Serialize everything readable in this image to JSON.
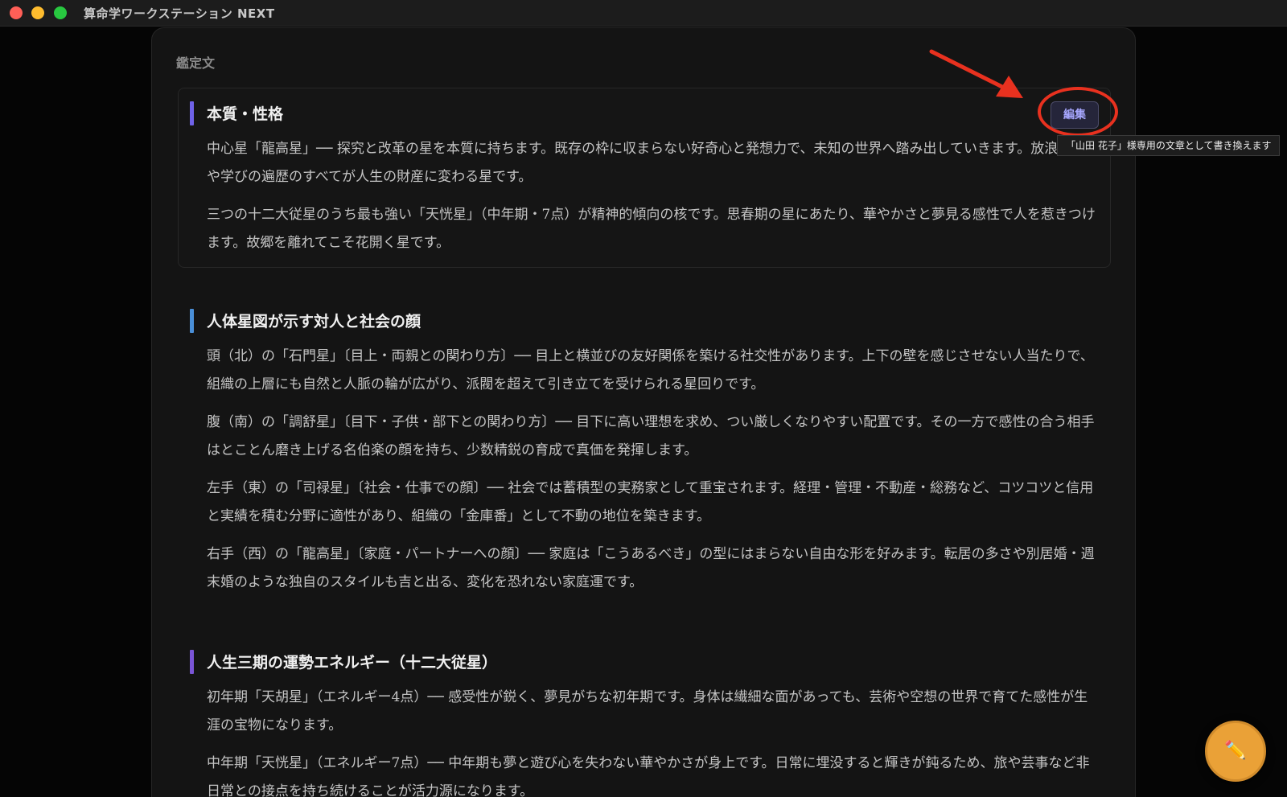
{
  "window": {
    "title": "算命学ワークステーション NEXT"
  },
  "panel": {
    "heading": "鑑定文"
  },
  "edit": {
    "label": "編集",
    "tooltip": "「山田 花子」様専用の文章として書き換えます"
  },
  "sections": [
    {
      "title": "本質・性格",
      "bar_color": "#6f62e8",
      "paragraphs": [
        "中心星「龍高星」── 探究と改革の星を本質に持ちます。既存の枠に収まらない好奇心と発想力で、未知の世界へ踏み出していきます。放浪や学びの遍歴のすべてが人生の財産に変わる星です。",
        "三つの十二大従星のうち最も強い「天恍星」（中年期・7点）が精神的傾向の核です。思春期の星にあたり、華やかさと夢見る感性で人を惹きつけます。故郷を離れてこそ花開く星です。"
      ]
    },
    {
      "title": "人体星図が示す対人と社会の顔",
      "bar_color": "#4a8fd8",
      "paragraphs": [
        "頭（北）の「石門星」〔目上・両親との関わり方〕── 目上と横並びの友好関係を築ける社交性があります。上下の壁を感じさせない人当たりで、組織の上層にも自然と人脈の輪が広がり、派閥を超えて引き立てを受けられる星回りです。",
        "腹（南）の「調舒星」〔目下・子供・部下との関わり方〕── 目下に高い理想を求め、つい厳しくなりやすい配置です。その一方で感性の合う相手はとことん磨き上げる名伯楽の顔を持ち、少数精鋭の育成で真価を発揮します。",
        "左手（東）の「司禄星」〔社会・仕事での顔〕── 社会では蓄積型の実務家として重宝されます。経理・管理・不動産・総務など、コツコツと信用と実績を積む分野に適性があり、組織の「金庫番」として不動の地位を築きます。",
        "右手（西）の「龍高星」〔家庭・パートナーへの顔〕── 家庭は「こうあるべき」の型にはまらない自由な形を好みます。転居の多さや別居婚・週末婚のような独自のスタイルも吉と出る、変化を恐れない家庭運です。"
      ]
    },
    {
      "title": "人生三期の運勢エネルギー（十二大従星）",
      "bar_color": "#7a55d6",
      "paragraphs": [
        "初年期「天胡星」（エネルギー4点）── 感受性が鋭く、夢見がちな初年期です。身体は繊細な面があっても、芸術や空想の世界で育てた感性が生涯の宝物になります。",
        "中年期「天恍星」（エネルギー7点）── 中年期も夢と遊び心を失わない華やかさが身上です。日常に埋没すると輝きが鈍るため、旅や芸事など非日常との接点を持ち続けることが活力源になります。"
      ]
    }
  ],
  "fab": {
    "icon": "pencil-icon",
    "glyph": "✏️"
  },
  "colors": {
    "accent_purple": "#6f62e8",
    "accent_blue": "#4a8fd8",
    "highlight_red": "#e8311f",
    "fab_orange": "#eaa137"
  }
}
